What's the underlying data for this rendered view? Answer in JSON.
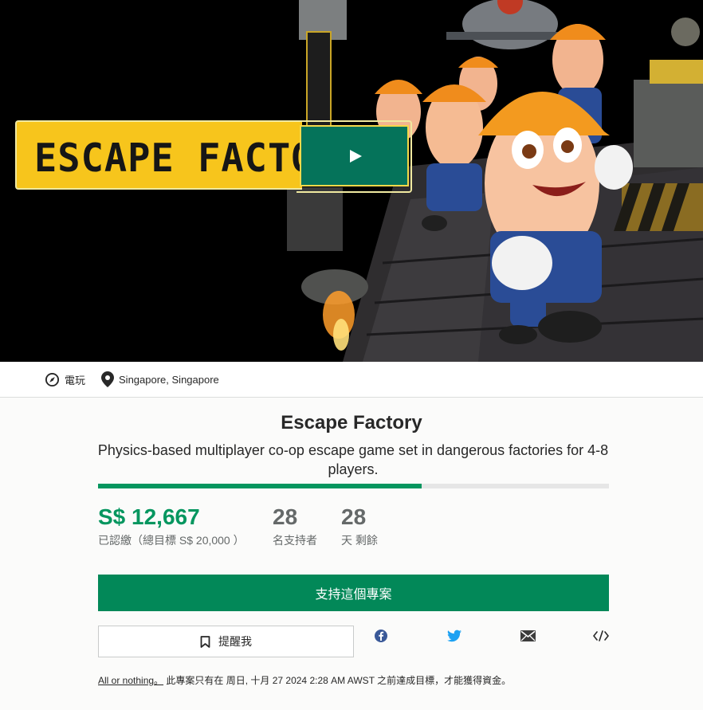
{
  "hero": {
    "game_logo_text": "ESCAPE FACTORY",
    "play_button_icon": "play-icon",
    "banner_color": "#f7c51c",
    "play_color": "#05735a"
  },
  "meta": {
    "category": "電玩",
    "location": "Singapore, Singapore"
  },
  "project": {
    "title": "Escape Factory",
    "blurb": "Physics-based multiplayer co-op escape game set in dangerous factories for 4-8 players."
  },
  "funding": {
    "progress_fraction": 0.633,
    "pledged": "S$ 12,667",
    "pledged_label": "已認繳（總目標 S$ 20,000 ）",
    "backers": "28",
    "backers_label": "名支持者",
    "days": "28",
    "days_label": "天 剩餘",
    "accent_color": "#05965f"
  },
  "actions": {
    "back_label": "支持這個專案",
    "remind_label": "提醒我",
    "share_icons": [
      "facebook-icon",
      "twitter-icon",
      "email-icon",
      "embed-icon"
    ]
  },
  "footer": {
    "all_or_nothing": "All or nothing。",
    "deadline_text": "此專案只有在 周日, 十月 27 2024 2:28 AM AWST 之前達成目標，才能獲得資金。"
  }
}
